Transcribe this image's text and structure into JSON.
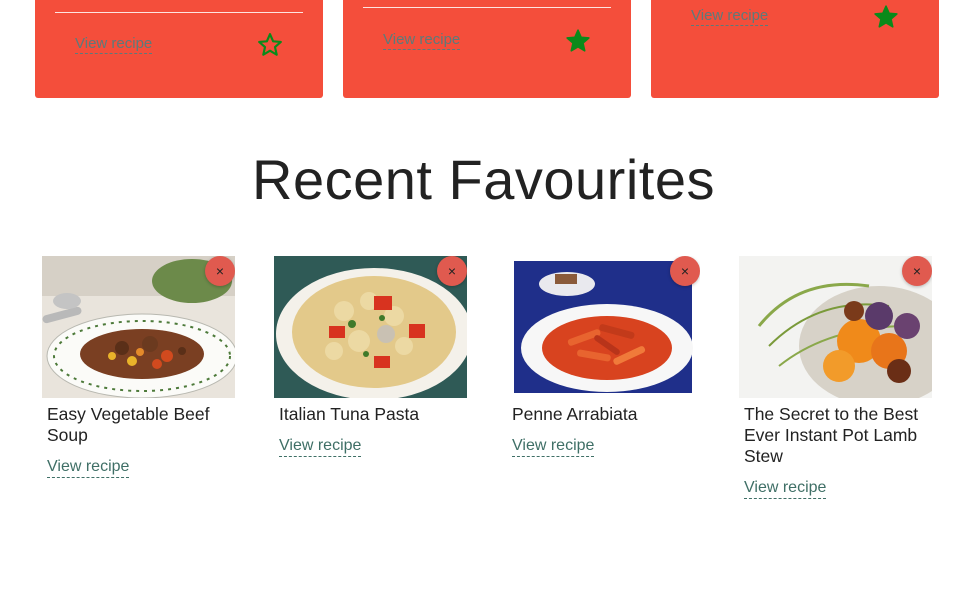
{
  "top_cards": [
    {
      "link": "View recipe",
      "favourited": false,
      "star_icon": "star-outline-icon"
    },
    {
      "link": "View recipe",
      "favourited": true,
      "star_icon": "star-filled-icon"
    },
    {
      "link": "View recipe",
      "favourited": true,
      "star_icon": "star-filled-icon"
    }
  ],
  "recent": {
    "title": "Recent Favourites",
    "remove_label": "×",
    "items": [
      {
        "title": "Easy Vegetable Beef Soup",
        "link": "View recipe"
      },
      {
        "title": "Italian Tuna Pasta",
        "link": "View recipe"
      },
      {
        "title": "Penne Arrabiata",
        "link": "View recipe"
      },
      {
        "title": "The Secret to the Best Ever Instant Pot Lamb Stew",
        "link": "View recipe"
      }
    ]
  },
  "colors": {
    "card_bg": "#f44e3b",
    "star_green": "#0a8a1a",
    "link_color": "#3f6f66",
    "remove_bg": "#e05a4f"
  }
}
